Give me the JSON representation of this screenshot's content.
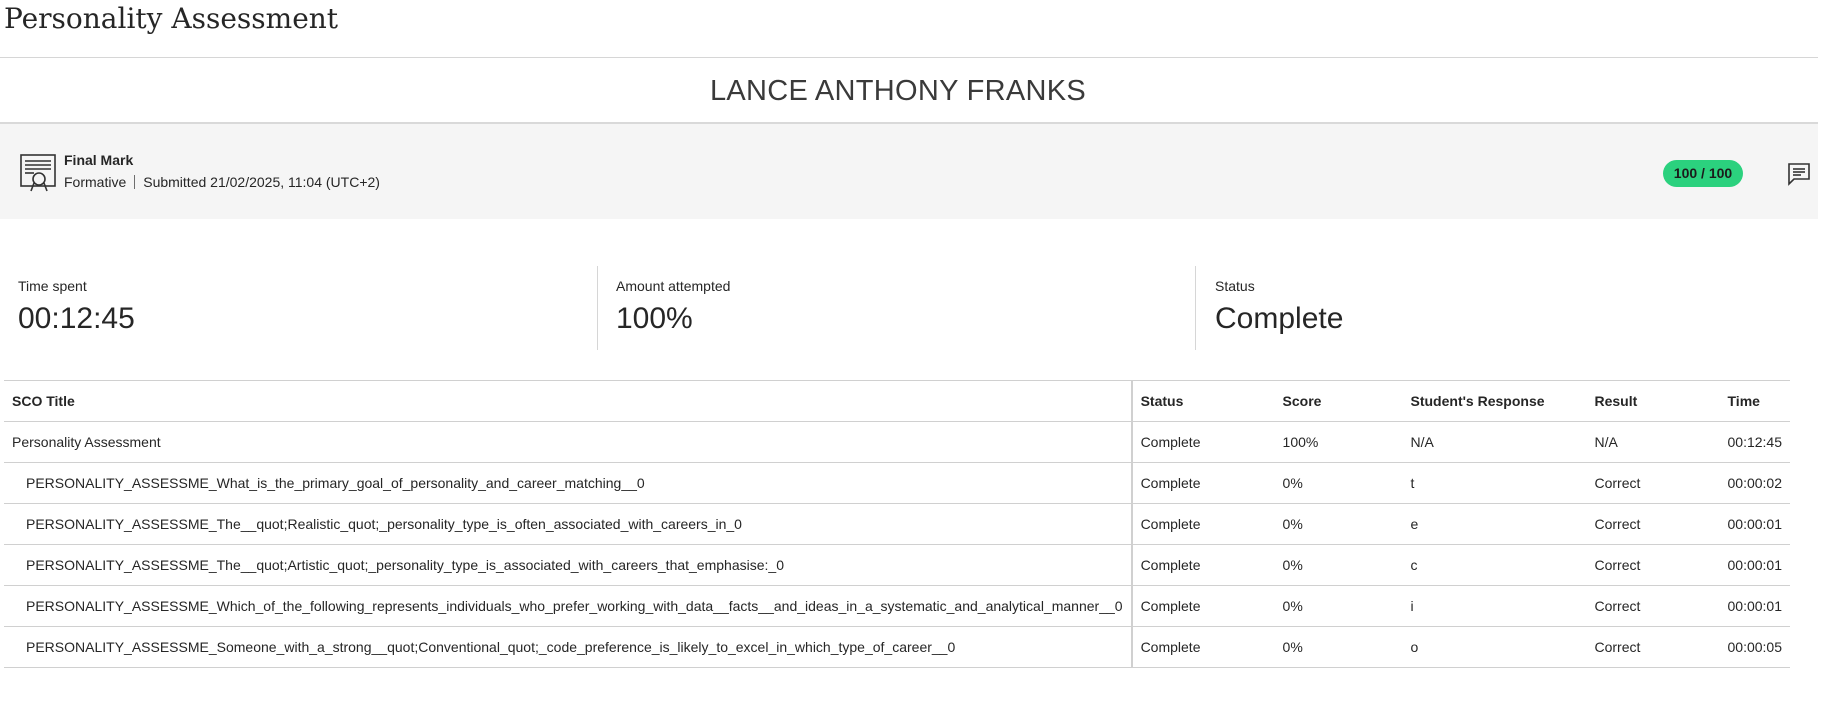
{
  "page": {
    "title": "Personality Assessment"
  },
  "student": {
    "name": "LANCE ANTHONY FRANKS"
  },
  "final_mark": {
    "title": "Final Mark",
    "type": "Formative",
    "submitted": "Submitted 21/02/2025, 11:04 (UTC+2)",
    "score": "100 / 100",
    "icons": {
      "attempt": "certificate-icon",
      "feedback": "feedback-comment-icon"
    },
    "colors": {
      "score_pill": "#2bd17e"
    }
  },
  "stats": {
    "time_spent": {
      "label": "Time spent",
      "value": "00:12:45"
    },
    "amount_attempted": {
      "label": "Amount attempted",
      "value": "100%"
    },
    "status": {
      "label": "Status",
      "value": "Complete"
    }
  },
  "table": {
    "headers": {
      "title": "SCO Title",
      "status": "Status",
      "score": "Score",
      "response": "Student's Response",
      "result": "Result",
      "time": "Time"
    },
    "rows": [
      {
        "title": "Personality Assessment",
        "status": "Complete",
        "score": "100%",
        "response": "N/A",
        "result": "N/A",
        "time": "00:12:45"
      },
      {
        "title": "PERSONALITY_ASSESSME_What_is_the_primary_goal_of_personality_and_career_matching__0",
        "status": "Complete",
        "score": "0%",
        "response": "t",
        "result": "Correct",
        "time": "00:00:02"
      },
      {
        "title": "PERSONALITY_ASSESSME_The__quot;Realistic_quot;_personality_type_is_often_associated_with_careers_in_0",
        "status": "Complete",
        "score": "0%",
        "response": "e",
        "result": "Correct",
        "time": "00:00:01"
      },
      {
        "title": "PERSONALITY_ASSESSME_The__quot;Artistic_quot;_personality_type_is_associated_with_careers_that_emphasise:_0",
        "status": "Complete",
        "score": "0%",
        "response": "c",
        "result": "Correct",
        "time": "00:00:01"
      },
      {
        "title": "PERSONALITY_ASSESSME_Which_of_the_following_represents_individuals_who_prefer_working_with_data__facts__and_ideas_in_a_systematic_and_analytical_manner__0",
        "status": "Complete",
        "score": "0%",
        "response": "i",
        "result": "Correct",
        "time": "00:00:01"
      },
      {
        "title": "PERSONALITY_ASSESSME_Someone_with_a_strong__quot;Conventional_quot;_code_preference_is_likely_to_excel_in_which_type_of_career__0",
        "status": "Complete",
        "score": "0%",
        "response": "o",
        "result": "Correct",
        "time": "00:00:05"
      }
    ]
  }
}
